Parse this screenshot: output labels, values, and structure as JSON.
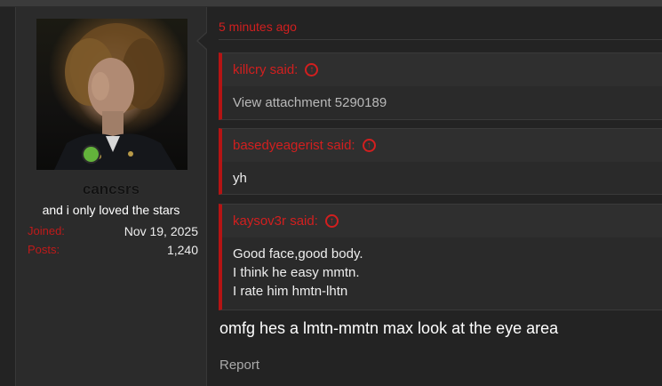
{
  "user": {
    "username": "cancsrs",
    "title": "and i only loved the stars",
    "stats": [
      {
        "key": "Joined:",
        "value": "Nov 19, 2025"
      },
      {
        "key": "Posts:",
        "value": "1,240"
      }
    ],
    "online_status_color": "#63b33b"
  },
  "post": {
    "timestamp": "5 minutes ago",
    "quotes": [
      {
        "author": "killcry said:",
        "lines": [
          "View attachment 5290189"
        ]
      },
      {
        "author": "basedyeagerist said:",
        "lines": [
          "yh"
        ]
      },
      {
        "author": "kaysov3r said:",
        "lines": [
          "Good face,good body.",
          "I think he easy mmtn.",
          "I rate him hmtn-lhtn"
        ]
      }
    ],
    "message": "omfg hes a lmtn-mmtn max look at the eye area",
    "report_label": "Report"
  },
  "colors": {
    "accent": "#d21f1f",
    "quote_bar": "#b51414",
    "background": "#232323",
    "user_panel": "#2b2b2b"
  },
  "icons": {
    "quote_jump": "arrow-up-circle-icon",
    "online": "online-status-icon"
  }
}
